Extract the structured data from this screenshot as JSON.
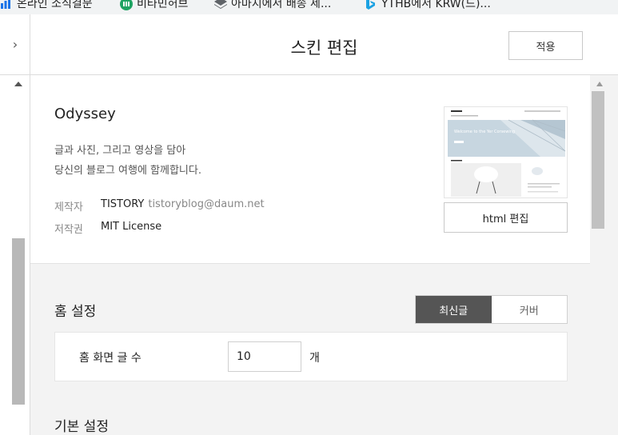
{
  "bookmarks": [
    {
      "label": "온라인 소식결문",
      "icon": "bar-chart-icon",
      "color": "#1a73e8"
    },
    {
      "label": "비타민허브",
      "icon": "green-circle-icon",
      "color": "#1ea362"
    },
    {
      "label": "아마지에서 배송 제...",
      "icon": "layers-icon",
      "color": "#5f6368"
    },
    {
      "label": "YTHB에서 KRW(드)...",
      "icon": "bing-icon",
      "color": "#1ba1e2"
    }
  ],
  "header": {
    "title": "스킨 편집",
    "apply_label": "적용",
    "toggle_glyph": "›"
  },
  "skin": {
    "name": "Odyssey",
    "desc_line1": "글과 사진, 그리고 영상을 담아",
    "desc_line2": "당신의 블로그 여행에 함께합니다.",
    "author_key": "제작자",
    "author_name": "TISTORY",
    "author_email": "tistoryblog@daum.net",
    "license_key": "저작권",
    "license_value": "MIT License",
    "preview_text": "Welcome to the Yer Corsewing",
    "html_edit_label": "html 편집"
  },
  "home_settings": {
    "title": "홈 설정",
    "segments": [
      "최신글",
      "커버"
    ],
    "selected_segment": "최신글",
    "posts_label": "홈 화면 글 수",
    "posts_value": "10",
    "posts_unit": "개"
  },
  "basic_settings": {
    "title": "기본 설정"
  },
  "colors": {
    "accent_dark": "#555555",
    "panel": "#ffffff",
    "background": "#f3f3f3"
  }
}
